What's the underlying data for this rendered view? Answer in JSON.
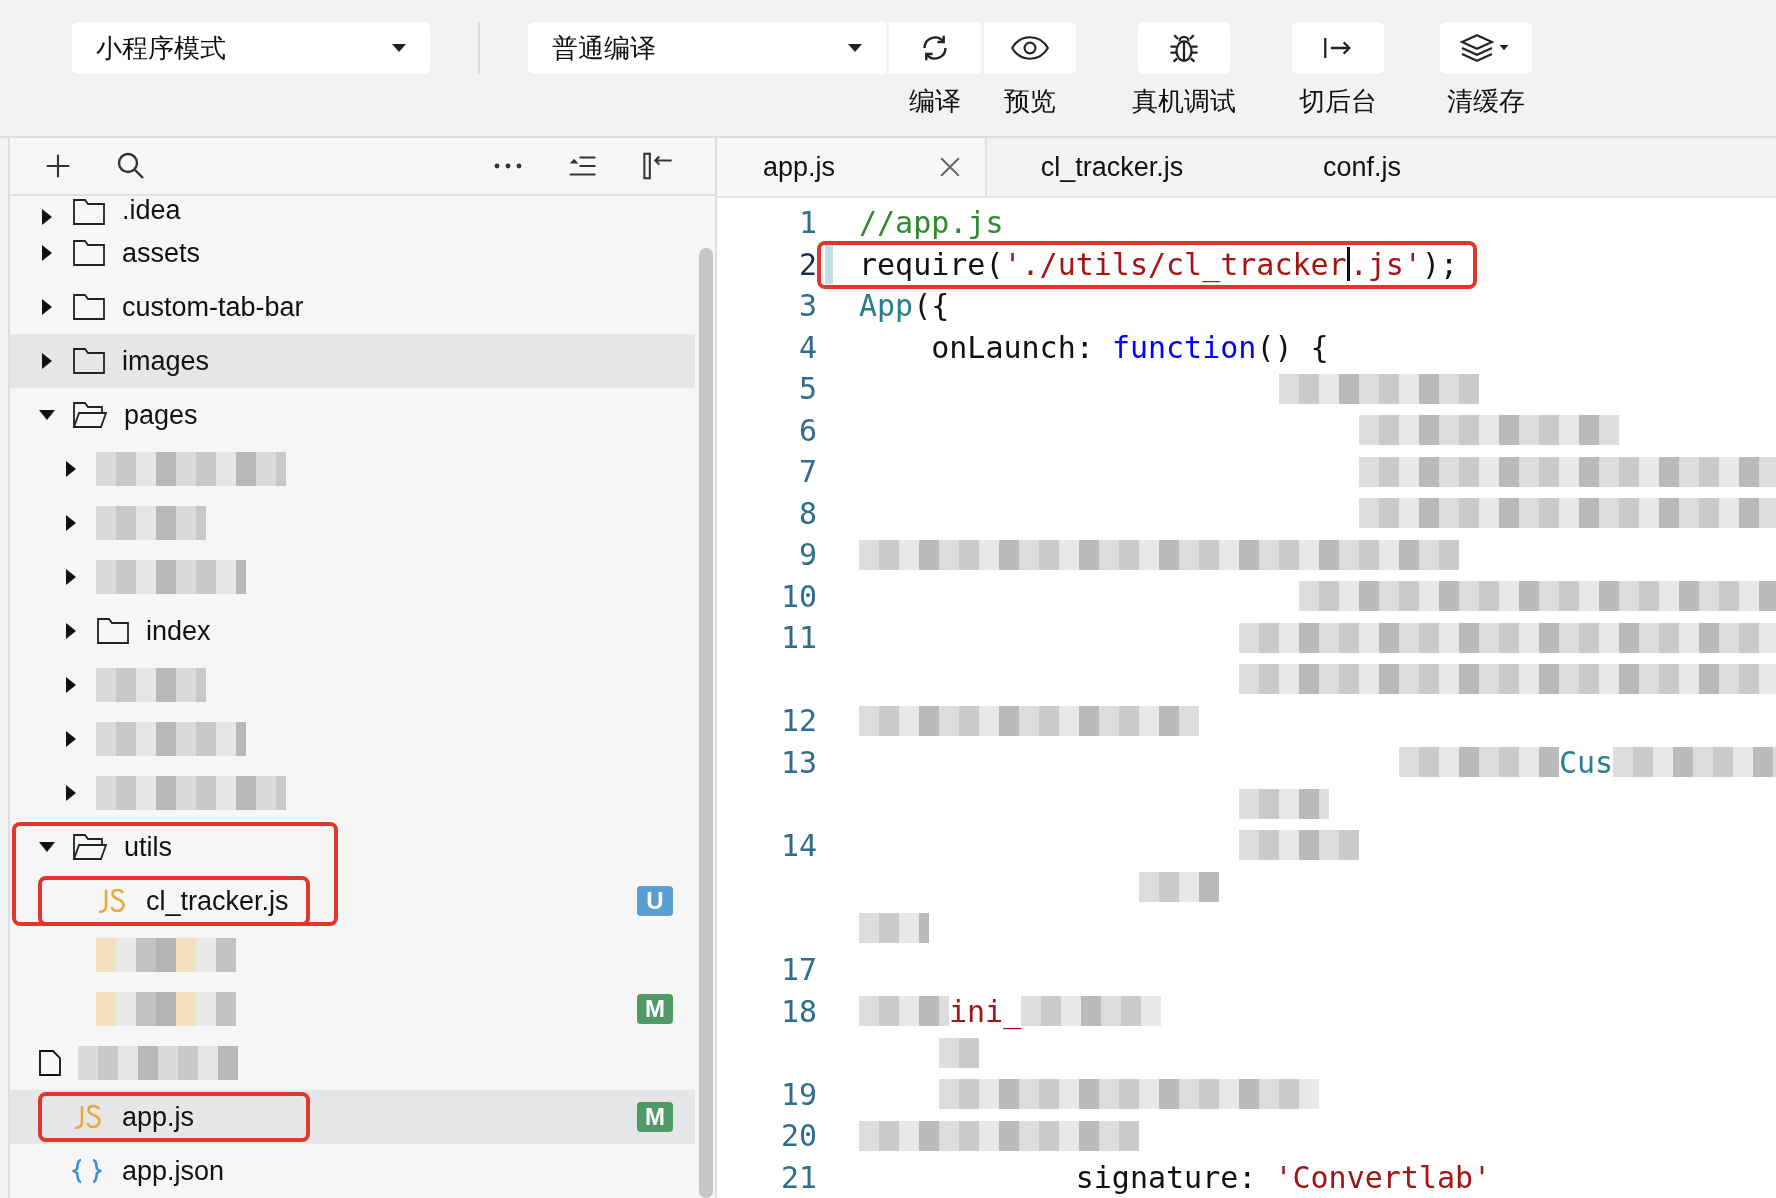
{
  "toolbar": {
    "mode_select": {
      "value": "小程序模式"
    },
    "compile_select": {
      "value": "普通编译"
    },
    "buttons": [
      {
        "kind": "refresh",
        "label": "编译"
      },
      {
        "kind": "eye",
        "label": "预览"
      },
      {
        "kind": "bug",
        "label": "真机调试"
      },
      {
        "kind": "switch",
        "label": "切后台"
      },
      {
        "kind": "layers",
        "label": "清缓存"
      }
    ]
  },
  "sidebar": {
    "tree": [
      {
        "kind": "folder",
        "name": ".idea",
        "expanded": false,
        "selected": false,
        "annotated": false
      },
      {
        "kind": "folder",
        "name": "assets",
        "expanded": false,
        "selected": false,
        "annotated": false
      },
      {
        "kind": "folder",
        "name": "custom-tab-bar",
        "expanded": false,
        "selected": false,
        "annotated": false
      },
      {
        "kind": "folder",
        "name": "images",
        "expanded": false,
        "selected": true,
        "annotated": false
      },
      {
        "kind": "folder",
        "name": "pages",
        "expanded": true,
        "selected": false,
        "annotated": false,
        "children": [
          {
            "kind": "redacted-folder"
          },
          {
            "kind": "redacted-folder"
          },
          {
            "kind": "redacted-folder"
          },
          {
            "kind": "folder",
            "name": "index",
            "expanded": false,
            "selected": false,
            "annotated": false
          },
          {
            "kind": "redacted-folder"
          },
          {
            "kind": "redacted-folder"
          },
          {
            "kind": "redacted-folder"
          }
        ]
      },
      {
        "kind": "folder",
        "name": "utils",
        "expanded": true,
        "selected": false,
        "annotated": true,
        "children": [
          {
            "kind": "js",
            "name": "cl_tracker.js",
            "selected": false,
            "annotated": true,
            "badge": {
              "text": "U",
              "color": "#5a9fd4"
            }
          },
          {
            "kind": "redacted-js"
          },
          {
            "kind": "redacted-js",
            "badge": {
              "text": "M",
              "color": "#4e9b68"
            }
          }
        ]
      },
      {
        "kind": "redacted-file"
      },
      {
        "kind": "js",
        "name": "app.js",
        "selected": true,
        "annotated": true,
        "badge": {
          "text": "M",
          "color": "#4e9b68"
        }
      },
      {
        "kind": "json",
        "name": "app.json",
        "selected": false,
        "annotated": false
      }
    ]
  },
  "editor": {
    "tabs": [
      {
        "label": "app.js",
        "selected": true
      },
      {
        "label": "cl_tracker.js",
        "selected": false
      },
      {
        "label": "conf.js",
        "selected": false
      }
    ],
    "lines": [
      {
        "number": "1",
        "segments": [
          {
            "kind": "comment",
            "text": "//app.js"
          }
        ]
      },
      {
        "number": "2",
        "current": true,
        "annotated": true,
        "segments": [
          {
            "kind": "plain",
            "text": "require("
          },
          {
            "kind": "string",
            "text": "'./utils/cl_tracker",
            "cursor": true
          },
          {
            "kind": "string",
            "text": ".js'"
          },
          {
            "kind": "plain",
            "text": ");"
          }
        ]
      },
      {
        "number": "3",
        "segments": [
          {
            "kind": "type",
            "text": "App"
          },
          {
            "kind": "plain",
            "text": "({"
          }
        ]
      },
      {
        "number": "4",
        "segments": [
          {
            "kind": "plain",
            "text": "    onLaunch: "
          },
          {
            "kind": "keyword",
            "text": "function"
          },
          {
            "kind": "plain",
            "text": "() {"
          }
        ]
      },
      {
        "number": "5",
        "segments": [
          {
            "kind": "redacted"
          }
        ]
      },
      {
        "number": "6",
        "segments": [
          {
            "kind": "redacted"
          }
        ]
      },
      {
        "number": "7",
        "segments": [
          {
            "kind": "redacted"
          }
        ]
      },
      {
        "number": "8",
        "segments": [
          {
            "kind": "redacted"
          }
        ]
      },
      {
        "number": "9",
        "segments": [
          {
            "kind": "redacted"
          }
        ]
      },
      {
        "number": "10",
        "segments": [
          {
            "kind": "redacted"
          }
        ]
      },
      {
        "number": "11",
        "segments": [
          {
            "kind": "redacted"
          }
        ]
      },
      {
        "segments": [
          {
            "kind": "redacted"
          }
        ]
      },
      {
        "number": "12",
        "segments": [
          {
            "kind": "redacted"
          }
        ]
      },
      {
        "number": "13",
        "segments": [
          {
            "kind": "redacted"
          },
          {
            "kind": "type",
            "text": "Cus"
          },
          {
            "kind": "redacted"
          }
        ]
      },
      {
        "segments": [
          {
            "kind": "redacted"
          }
        ]
      },
      {
        "number": "14",
        "segments": [
          {
            "kind": "redacted"
          }
        ]
      },
      {
        "segments": [
          {
            "kind": "redacted"
          }
        ]
      },
      {
        "segments": [
          {
            "kind": "redacted"
          }
        ]
      },
      {
        "number": "17"
      },
      {
        "number": "18",
        "segments": [
          {
            "kind": "redacted"
          },
          {
            "kind": "string",
            "text": "ini_"
          },
          {
            "kind": "redacted"
          }
        ]
      },
      {
        "segments": [
          {
            "kind": "redacted"
          }
        ]
      },
      {
        "number": "19",
        "segments": [
          {
            "kind": "redacted"
          }
        ]
      },
      {
        "number": "20",
        "segments": [
          {
            "kind": "redacted"
          }
        ]
      },
      {
        "number": "21",
        "segments": [
          {
            "kind": "plain",
            "text": "            signature: "
          },
          {
            "kind": "string",
            "text": "'Convertlab'"
          }
        ]
      }
    ]
  }
}
